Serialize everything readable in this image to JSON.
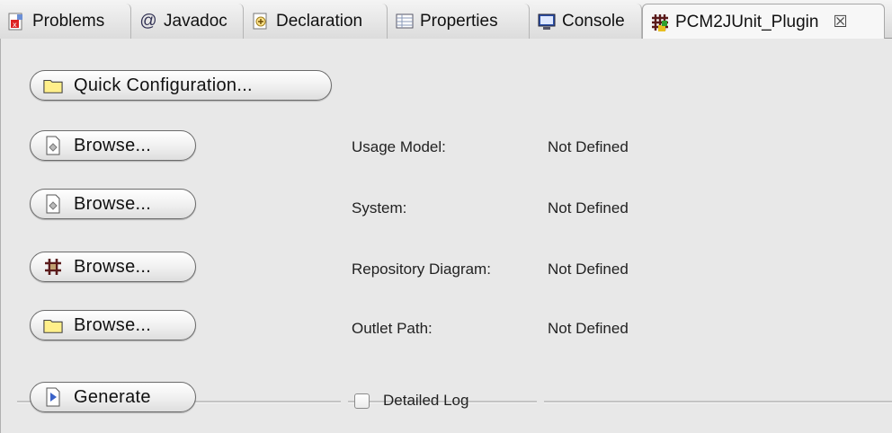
{
  "tabs": [
    {
      "label": "Problems",
      "icon": "problems-icon"
    },
    {
      "label": "Javadoc",
      "icon": "at-icon"
    },
    {
      "label": "Declaration",
      "icon": "declaration-icon"
    },
    {
      "label": "Properties",
      "icon": "properties-icon"
    },
    {
      "label": "Console",
      "icon": "console-icon"
    },
    {
      "label": "PCM2JUnit_Plugin",
      "icon": "plugin-icon",
      "active": true,
      "close_glyph": "☒"
    }
  ],
  "buttons": {
    "quick_config": "Quick Configuration...",
    "browse_usage": "Browse...",
    "browse_system": "Browse...",
    "browse_repository": "Browse...",
    "browse_outlet": "Browse...",
    "generate": "Generate"
  },
  "fields": {
    "usage_model": {
      "label": "Usage Model:",
      "value": "Not Defined"
    },
    "system": {
      "label": "System:",
      "value": "Not Defined"
    },
    "repository_diagram": {
      "label": "Repository Diagram:",
      "value": "Not Defined"
    },
    "outlet_path": {
      "label": "Outlet Path:",
      "value": "Not Defined"
    }
  },
  "detailed_log": {
    "label": "Detailed Log",
    "checked": false
  },
  "colors": {
    "folder": "#ffef8a",
    "generate_arrow": "#3a62c8",
    "grid": "#6b1f1f"
  }
}
